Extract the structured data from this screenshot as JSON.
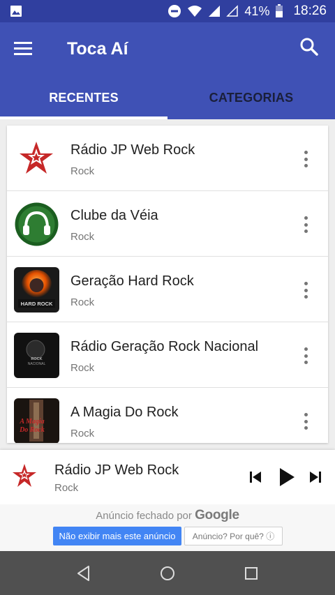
{
  "status_bar": {
    "battery": "41%",
    "time": "18:26",
    "icons": [
      "image-icon",
      "do-not-disturb-icon",
      "wifi-icon",
      "signal-icon",
      "signal-empty-icon",
      "battery-icon"
    ]
  },
  "app_bar": {
    "title": "Toca Aí",
    "menu_icon": "menu-icon",
    "search_icon": "search-icon",
    "tabs": [
      {
        "label": "RECENTES",
        "active": true
      },
      {
        "label": "CATEGORIAS",
        "active": false
      }
    ]
  },
  "stations": [
    {
      "name": "Rádio JP Web Rock",
      "genre": "Rock",
      "thumb": "jp-web-rock-logo"
    },
    {
      "name": "Clube da Véia",
      "genre": "Rock",
      "thumb": "clube-da-veia-logo"
    },
    {
      "name": "Geração Hard Rock",
      "genre": "Rock",
      "thumb": "geracao-hard-rock-logo",
      "thumb_text": "HARD ROCK"
    },
    {
      "name": "Rádio Geração Rock Nacional",
      "genre": "Rock",
      "thumb": "geracao-rock-nacional-logo",
      "thumb_text": "ROCK NACIONAL"
    },
    {
      "name": "A Magia Do Rock",
      "genre": "Rock",
      "thumb": "a-magia-do-rock-logo",
      "thumb_text": "A Magia Do Rock"
    }
  ],
  "player": {
    "title": "Rádio JP Web Rock",
    "subtitle": "Rock",
    "controls": [
      "skip-previous-icon",
      "play-icon",
      "skip-next-icon"
    ]
  },
  "ad": {
    "closed_label": "Anúncio fechado por",
    "brand": "Google",
    "hide_button": "Não exibir mais este anúncio",
    "why_button": "Anúncio? Por quê? ⓘ"
  },
  "nav_bar": [
    "back-icon",
    "home-icon",
    "recents-icon"
  ],
  "colors": {
    "primary": "#3f51b5",
    "primary_dark": "#303f9f",
    "ad_button": "#4285f4"
  }
}
